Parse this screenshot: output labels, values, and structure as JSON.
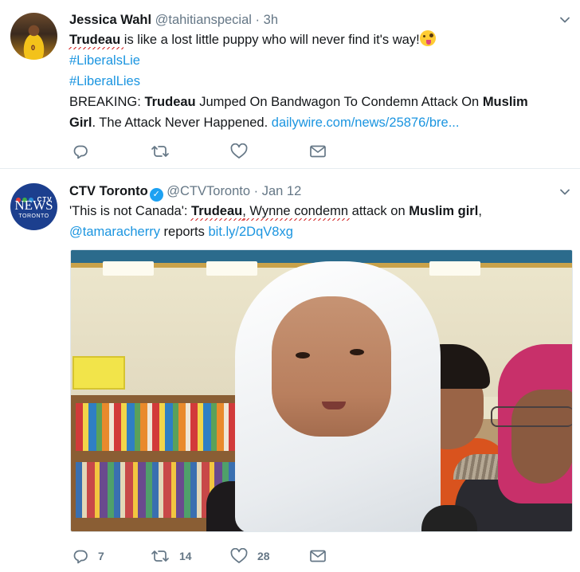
{
  "tweets": [
    {
      "display_name": "Jessica Wahl",
      "handle": "@tahitianspecial",
      "separator": "·",
      "time": "3h",
      "avatar_jersey_number": "0",
      "text": {
        "l1_name": "Trudeau",
        "l1_rest": " is like a lost little puppy who will never find it's way!",
        "l1_emoji": "winking-face-with-tongue",
        "hashtag1": "#LiberalsLie",
        "hashtag2": "#LiberalLies",
        "l4_a": "BREAKING: ",
        "l4_b": "Trudeau",
        "l4_c": " Jumped On Bandwagon To Condemn Attack On ",
        "l4_d": "Muslim",
        "l5_a": "Girl",
        "l5_b": ". The Attack Never Happened. ",
        "l5_link": "dailywire.com/news/25876/bre..."
      },
      "actions": {
        "reply": "",
        "retweet": "",
        "like": ""
      }
    },
    {
      "display_name": "CTV Toronto",
      "handle": "@CTVToronto",
      "separator": "·",
      "time": "Jan 12",
      "avatar_brand": "CTV",
      "avatar_word": "NEWS",
      "avatar_city": "TORONTO",
      "text": {
        "l1_a": "'This is not Canada': ",
        "l1_b": "Trudeau",
        "l1_c": ", Wynne condemn",
        "l1_d": " attack on ",
        "l1_e": "Muslim girl",
        "l1_f": ",",
        "l2_mention": "@tamaracherry",
        "l2_mid": " reports ",
        "l2_link": "bit.ly/2DqV8xg"
      },
      "actions": {
        "reply": "7",
        "retweet": "14",
        "like": "28"
      }
    }
  ],
  "colors": {
    "link": "#1b95e0",
    "muted": "#657786",
    "text": "#14171a",
    "verified": "#1da1f2",
    "underline_marker": "#d42a2a"
  },
  "icons": [
    "caret-down-icon",
    "reply-icon",
    "retweet-icon",
    "like-icon",
    "direct-message-icon",
    "verified-badge-icon"
  ]
}
